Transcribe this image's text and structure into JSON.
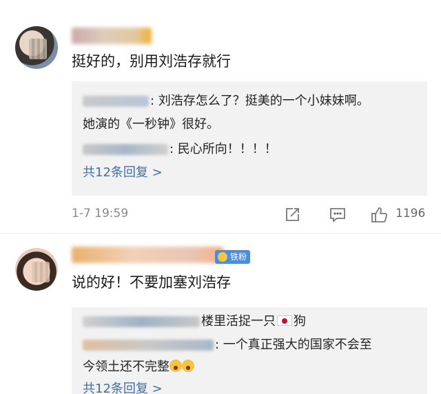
{
  "comment1": {
    "text": "挺好的，别用刘浩存就行",
    "replies": {
      "line1_text": ": 刘浩存怎么了？挺美的一个小妹妹啊。",
      "line1_cont": "她演的《一秒钟》很好。",
      "line2_text": ": 民心所向！！！！",
      "more": "共12条回复 >"
    },
    "timestamp": "1-7 19:59",
    "likes": "1196"
  },
  "comment2": {
    "badge": "铁粉",
    "text": "说的好！不要加塞刘浩存",
    "replies": {
      "line1_text": "楼里活捉一只",
      "line1_suffix": "狗",
      "line2_text": ": 一个真正强大的国家不会至",
      "line2_cont": "今领土还不完整",
      "more": "共12条回复 >"
    }
  },
  "icons": {
    "share": "share-icon",
    "comment": "comment-icon",
    "like": "thumbs-up-icon"
  }
}
